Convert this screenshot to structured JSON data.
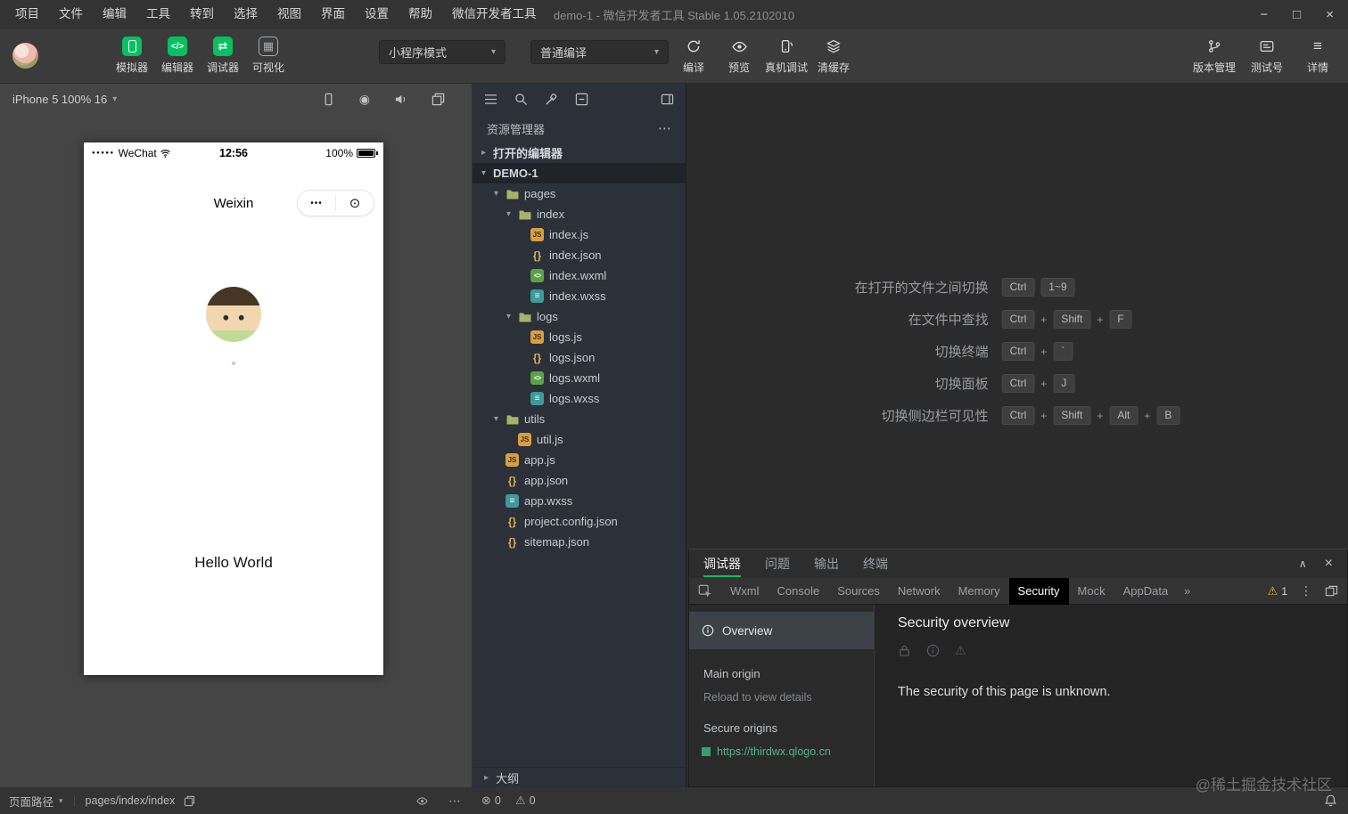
{
  "icons": {
    "minimize": "−",
    "maximize": "□",
    "close": "×",
    "caret_down": "▾",
    "ellipsis": "⋯",
    "kebab": "⋮",
    "more_tabs": "»",
    "record": "◉",
    "capsule_dots": "•••",
    "capsule_target": "⊙",
    "signal_dots": "●●●●●",
    "error_circle": "⊗",
    "warning_triangle": "⚠",
    "grid": "▦",
    "code": "</>",
    "swap": "⇄",
    "hamburger": "≡",
    "collapse_up": "∧",
    "chevron_right": "▸"
  },
  "menubar": {
    "items": [
      "项目",
      "文件",
      "编辑",
      "工具",
      "转到",
      "选择",
      "视图",
      "界面",
      "设置",
      "帮助",
      "微信开发者工具"
    ],
    "window_title": "demo-1 - 微信开发者工具 Stable 1.05.2102010"
  },
  "toolbar": {
    "buttons": [
      {
        "label": "模拟器"
      },
      {
        "label": "编辑器"
      },
      {
        "label": "调试器"
      },
      {
        "label": "可视化"
      }
    ],
    "mode_select": "小程序模式",
    "compile_select": "普通编译",
    "actions": [
      {
        "label": "编译"
      },
      {
        "label": "预览"
      },
      {
        "label": "真机调试"
      },
      {
        "label": "清缓存"
      }
    ],
    "right_actions": [
      {
        "label": "版本管理"
      },
      {
        "label": "测试号"
      },
      {
        "label": "详情"
      }
    ]
  },
  "simulator": {
    "device_label": "iPhone 5 100% 16",
    "phone": {
      "carrier": "WeChat",
      "time": "12:56",
      "battery_percent": "100%",
      "nav_title": "Weixin",
      "hello_text": "Hello World"
    }
  },
  "explorer": {
    "title": "资源管理器",
    "tree": [
      {
        "label": "打开的编辑器",
        "depth": 0,
        "chevron": "right",
        "section": true
      },
      {
        "label": "DEMO-1",
        "depth": 0,
        "chevron": "down",
        "section": true,
        "selected": true
      },
      {
        "label": "pages",
        "depth": 1,
        "chevron": "down",
        "icon": "folder"
      },
      {
        "label": "index",
        "depth": 2,
        "chevron": "down",
        "icon": "folder"
      },
      {
        "label": "index.js",
        "depth": 3,
        "icon": "js"
      },
      {
        "label": "index.json",
        "depth": 3,
        "icon": "json"
      },
      {
        "label": "index.wxml",
        "depth": 3,
        "icon": "wxml"
      },
      {
        "label": "index.wxss",
        "depth": 3,
        "icon": "wxss"
      },
      {
        "label": "logs",
        "depth": 2,
        "chevron": "down",
        "icon": "folder"
      },
      {
        "label": "logs.js",
        "depth": 3,
        "icon": "js"
      },
      {
        "label": "logs.json",
        "depth": 3,
        "icon": "json"
      },
      {
        "label": "logs.wxml",
        "depth": 3,
        "icon": "wxml"
      },
      {
        "label": "logs.wxss",
        "depth": 3,
        "icon": "wxss"
      },
      {
        "label": "utils",
        "depth": 1,
        "chevron": "down",
        "icon": "folder"
      },
      {
        "label": "util.js",
        "depth": 2,
        "icon": "js"
      },
      {
        "label": "app.js",
        "depth": 1,
        "icon": "js"
      },
      {
        "label": "app.json",
        "depth": 1,
        "icon": "json"
      },
      {
        "label": "app.wxss",
        "depth": 1,
        "icon": "wxss"
      },
      {
        "label": "project.config.json",
        "depth": 1,
        "icon": "json"
      },
      {
        "label": "sitemap.json",
        "depth": 1,
        "icon": "json"
      }
    ],
    "outline_label": "大纲"
  },
  "editor": {
    "shortcuts": [
      {
        "label": "在打开的文件之间切换",
        "keys": [
          "Ctrl",
          "1~9"
        ],
        "plus": false
      },
      {
        "label": "在文件中查找",
        "keys": [
          "Ctrl",
          "Shift",
          "F"
        ],
        "plus": true
      },
      {
        "label": "切换终端",
        "keys": [
          "Ctrl",
          "`"
        ],
        "plus": true
      },
      {
        "label": "切换面板",
        "keys": [
          "Ctrl",
          "J"
        ],
        "plus": true
      },
      {
        "label": "切换侧边栏可见性",
        "keys": [
          "Ctrl",
          "Shift",
          "Alt",
          "B"
        ],
        "plus": true
      }
    ]
  },
  "debugger": {
    "tabs": [
      "调试器",
      "问题",
      "输出",
      "终端"
    ],
    "active_tab": "调试器",
    "devtools_tabs": [
      "Wxml",
      "Console",
      "Sources",
      "Network",
      "Memory",
      "Security",
      "Mock",
      "AppData"
    ],
    "active_devtools_tab": "Security",
    "warning_count": "1",
    "security": {
      "overview_label": "Overview",
      "main_origin_label": "Main origin",
      "reload_hint": "Reload to view details",
      "secure_origins_label": "Secure origins",
      "origin_url": "https://thirdwx.qlogo.cn",
      "panel_title": "Security overview",
      "status_text": "The security of this page is unknown."
    }
  },
  "statusbar": {
    "page_path_label": "页面路径",
    "page_path_value": "pages/index/index",
    "error_count": "0",
    "warning_count": "0"
  },
  "watermark": "@稀土掘金技术社区",
  "colors": {
    "accent_green": "#07c160",
    "warning_yellow": "#e8b339",
    "origin_link": "#54b38a"
  }
}
